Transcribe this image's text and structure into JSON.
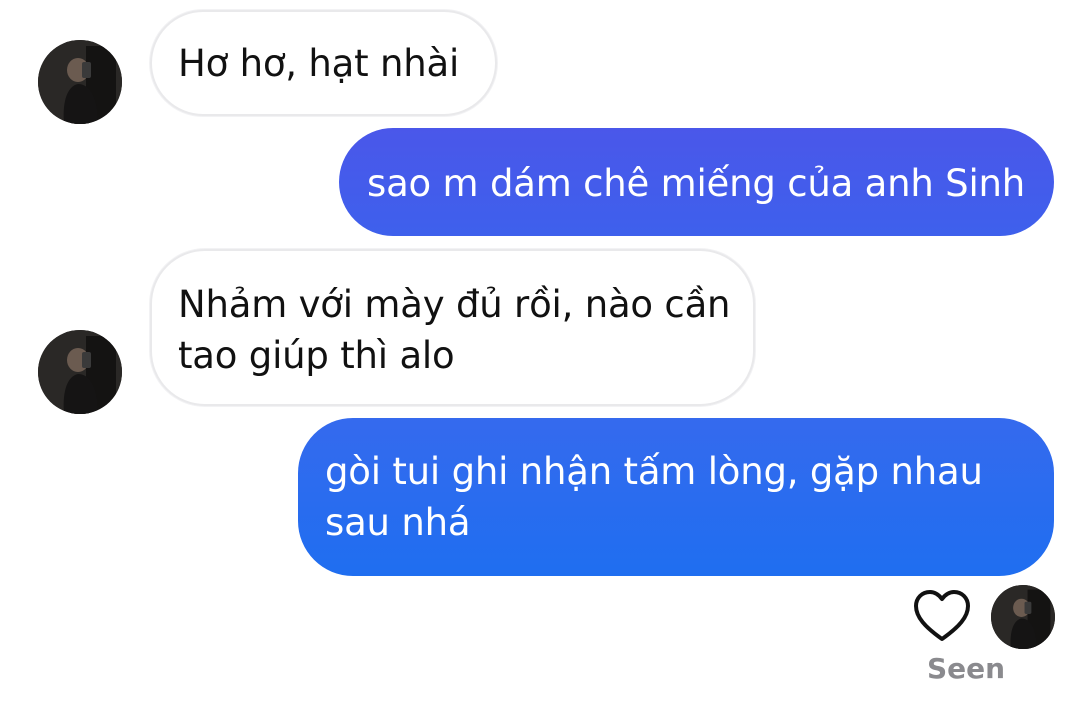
{
  "messages": [
    {
      "from": "other",
      "lines": [
        "Hơ hơ, hạt nhài"
      ]
    },
    {
      "from": "me",
      "lines": [
        "sao m dám chê miếng của anh Sinh"
      ]
    },
    {
      "from": "other",
      "lines": [
        "Nhảm với mày đủ rồi, nào cần",
        "tao giúp thì alo"
      ]
    },
    {
      "from": "me",
      "lines": [
        "gòi tui ghi nhận tấm lòng, gặp nhau",
        "sau nhá"
      ]
    }
  ],
  "status": {
    "seen": "Seen",
    "reaction_icon": "heart-outline-icon"
  },
  "colors": {
    "incoming_bubble": "#ffffff",
    "outgoing_gradient_top": "#4a57ea",
    "outgoing_gradient_bottom": "#1f6ef0"
  }
}
